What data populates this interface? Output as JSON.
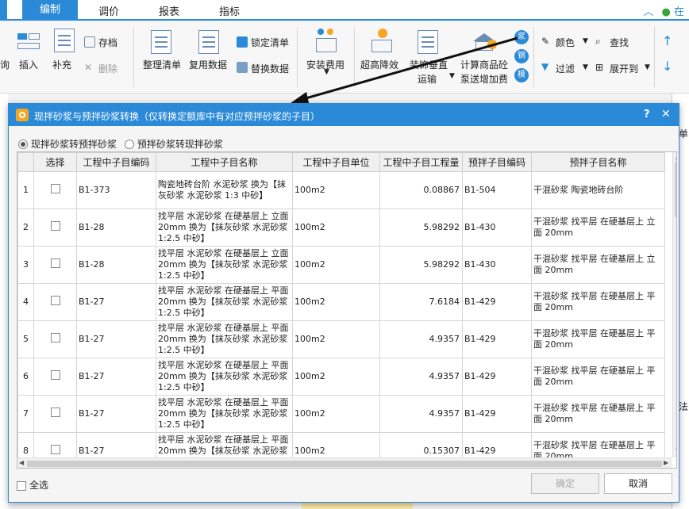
{
  "menubar": {
    "tabs": [
      "编制",
      "调价",
      "报表",
      "指标"
    ],
    "active": "编制",
    "right_text": "在"
  },
  "ribbon": {
    "cut_left": "询",
    "insert": "插入",
    "supplement": "补充",
    "archive": "存档",
    "delete": "删除",
    "arrange": "整理清单",
    "reuse": "复用数据",
    "lock": "锁定清单",
    "replace": "替换数据",
    "install_fee": "安装费用",
    "height_fee": "超高降效",
    "transport_1": "装饰垂直",
    "transport_2": "运输",
    "pump_1": "计算商品砼",
    "pump_2": "泵送增加费",
    "circles": [
      "浆",
      "钢",
      "模"
    ],
    "color": "颜色",
    "find": "查找",
    "filter": "过滤",
    "expand": "展开到"
  },
  "bg": {
    "right_label_top": "单",
    "right_label_mid": "法"
  },
  "dialog": {
    "title": "现拌砂浆与预拌砂浆转换（仅转换定额库中有对应预拌砂浆的子目）",
    "help": "?",
    "close": "✕",
    "radio_1": "现拌砂浆转预拌砂浆",
    "radio_2": "预拌砂浆转现拌砂浆",
    "select_all": "全选",
    "ok": "确定",
    "cancel": "取消"
  },
  "table": {
    "headers": [
      "",
      "选择",
      "工程中子目编码",
      "工程中子目名称",
      "工程中子目单位",
      "工程中子目工程量",
      "预拌子目编码",
      "预拌子目名称"
    ],
    "rows": [
      {
        "idx": "1",
        "code": "B1-373",
        "name": "陶瓷地砖台阶 水泥砂浆  换为【抹灰砂浆 水泥砂浆 1:3 中砂】",
        "unit": "100m2",
        "qty": "0.08867",
        "pcode": "B1-504",
        "pname": "干混砂浆 陶瓷地砖台阶"
      },
      {
        "idx": "2",
        "code": "B1-28",
        "name": "找平层 水泥砂浆 在硬基层上 立面 20mm  换为【抹灰砂浆 水泥砂浆 1:2.5 中砂】",
        "unit": "100m2",
        "qty": "5.98292",
        "pcode": "B1-430",
        "pname": "干混砂浆 找平层 在硬基层上 立面 20mm"
      },
      {
        "idx": "3",
        "code": "B1-28",
        "name": "找平层 水泥砂浆 在硬基层上 立面 20mm  换为【抹灰砂浆 水泥砂浆 1:2.5 中砂】",
        "unit": "100m2",
        "qty": "5.98292",
        "pcode": "B1-430",
        "pname": "干混砂浆 找平层 在硬基层上 立面 20mm"
      },
      {
        "idx": "4",
        "code": "B1-27",
        "name": "找平层 水泥砂浆 在硬基层上 平面 20mm  换为【抹灰砂浆 水泥砂浆 1:2.5 中砂】",
        "unit": "100m2",
        "qty": "7.6184",
        "pcode": "B1-429",
        "pname": "干混砂浆 找平层 在硬基层上 平面 20mm"
      },
      {
        "idx": "5",
        "code": "B1-27",
        "name": "找平层 水泥砂浆 在硬基层上 平面 20mm  换为【抹灰砂浆 水泥砂浆 1:2.5 中砂】",
        "unit": "100m2",
        "qty": "4.9357",
        "pcode": "B1-429",
        "pname": "干混砂浆 找平层 在硬基层上 平面 20mm"
      },
      {
        "idx": "6",
        "code": "B1-27",
        "name": "找平层 水泥砂浆 在硬基层上 平面 20mm  换为【抹灰砂浆 水泥砂浆 1:2.5 中砂】",
        "unit": "100m2",
        "qty": "4.9357",
        "pcode": "B1-429",
        "pname": "干混砂浆 找平层 在硬基层上 平面 20mm"
      },
      {
        "idx": "7",
        "code": "B1-27",
        "name": "找平层 水泥砂浆 在硬基层上 平面 20mm  换为【抹灰砂浆 水泥砂浆 1:2.5 中砂】",
        "unit": "100m2",
        "qty": "4.9357",
        "pcode": "B1-429",
        "pname": "干混砂浆 找平层 在硬基层上 平面 20mm"
      },
      {
        "idx": "8",
        "code": "B1-27",
        "name": "找平层 水泥砂浆 在硬基层上 平面 20mm  换为【抹灰砂浆 水泥砂浆 1:2.5 中砂】",
        "unit": "100m2",
        "qty": "0.15307",
        "pcode": "B1-429",
        "pname": "干混砂浆 找平层 在硬基层上 平面 20mm"
      }
    ]
  },
  "colors": {
    "accent": "#2b8ad8",
    "title_text": "#ffffff",
    "disabled": "#a8a8a8"
  }
}
